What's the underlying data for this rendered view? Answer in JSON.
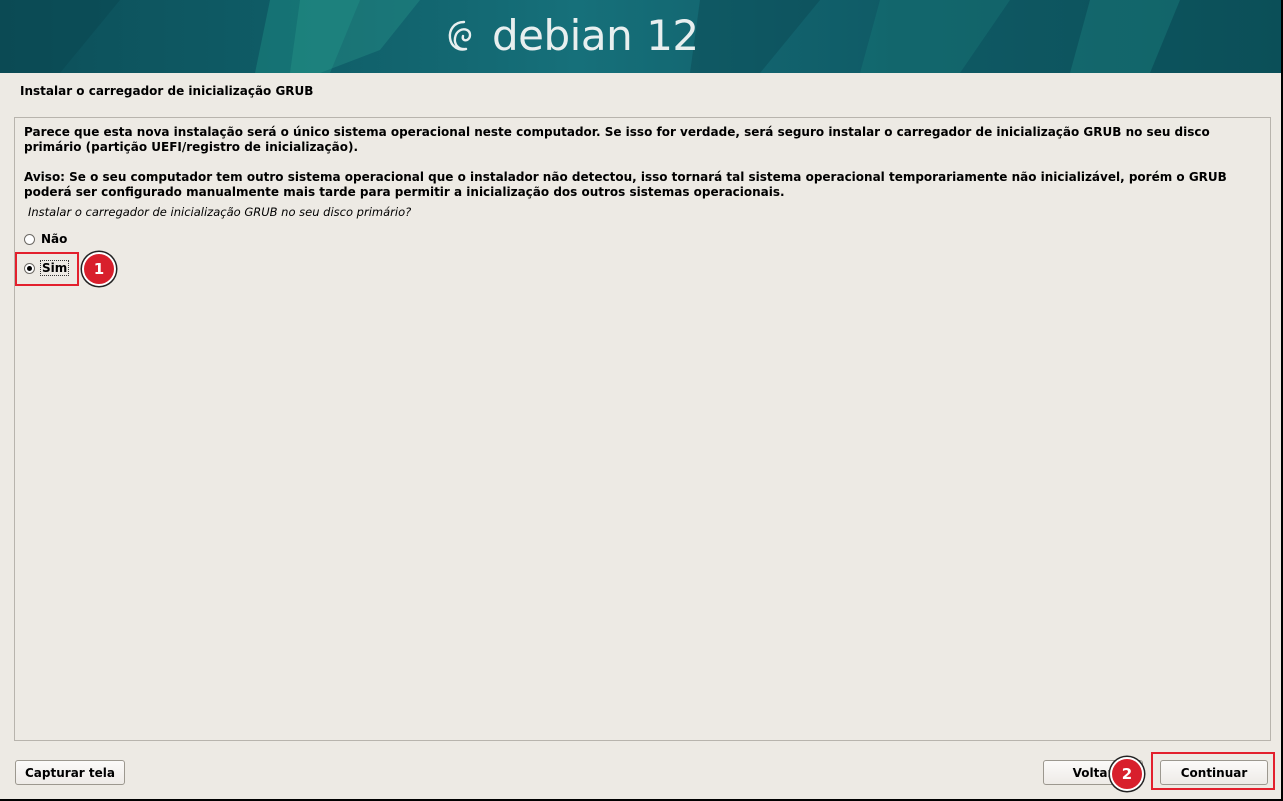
{
  "banner": {
    "brand": "debian",
    "version": "12"
  },
  "page": {
    "title": "Instalar o carregador de inicialização GRUB"
  },
  "description": {
    "paragraph1": "Parece que esta nova instalação será o único sistema operacional neste computador. Se isso for verdade, será seguro instalar o carregador de inicialização GRUB no seu disco primário (partição UEFI/registro de inicialização).",
    "paragraph2": "Aviso: Se o seu computador tem outro sistema operacional que o instalador não detectou, isso tornará tal sistema operacional temporariamente não inicializável, porém o GRUB poderá ser configurado manualmente mais tarde para permitir a inicialização dos outros sistemas operacionais."
  },
  "question": "Instalar o carregador de inicialização GRUB no seu disco primário?",
  "options": [
    {
      "label": "Não",
      "selected": false
    },
    {
      "label": "Sim",
      "selected": true
    }
  ],
  "buttons": {
    "screenshot": "Capturar tela",
    "back": "Voltar",
    "continue": "Continuar"
  },
  "annotations": {
    "step1": "1",
    "step2": "2"
  },
  "colors": {
    "annotation_red": "#d81f2c",
    "banner_teal": "#0f5c66",
    "background": "#edeae4"
  }
}
